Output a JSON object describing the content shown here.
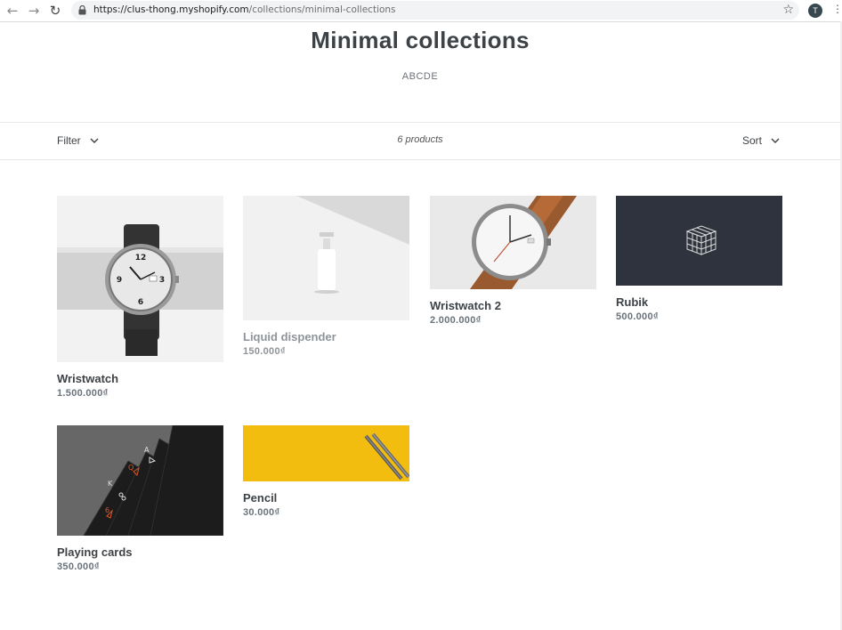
{
  "browser": {
    "url_host": "https://clus-thong.myshopify.com",
    "url_path": "/collections/minimal-collections",
    "profile_initial": "T",
    "icons": [
      "back-arrow-icon",
      "forward-arrow-icon",
      "reload-icon",
      "lock-icon",
      "star-icon",
      "kebab-menu-icon"
    ]
  },
  "collection": {
    "title": "Minimal collections",
    "description": "ABCDE"
  },
  "toolbar": {
    "filter_label": "Filter",
    "product_count": "6 products",
    "sort_label": "Sort"
  },
  "products": [
    {
      "name": "Wristwatch",
      "price": "1.500.000₫"
    },
    {
      "name": "Liquid dispender",
      "price": "150.000₫"
    },
    {
      "name": "Wristwatch 2",
      "price": "2.000.000₫"
    },
    {
      "name": "Rubik",
      "price": "500.000₫"
    },
    {
      "name": "Playing cards",
      "price": "350.000₫"
    },
    {
      "name": "Pencil",
      "price": "30.000₫"
    }
  ],
  "colors": {
    "accent": "#3d4246",
    "muted": "#69727b",
    "pencil_bg": "#f3bd10",
    "rubik_bg": "#2f333d"
  }
}
